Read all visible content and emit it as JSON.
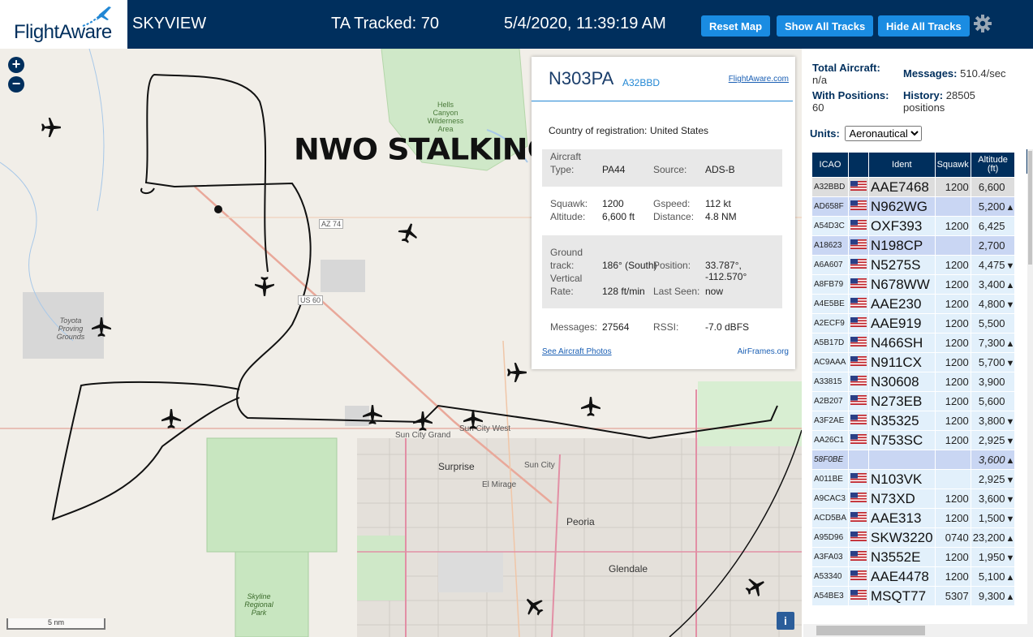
{
  "header": {
    "logo_text": "FlightAware",
    "app_title": "SKYVIEW",
    "tracked": "TA Tracked: 70",
    "datetime": "5/4/2020, 11:39:19 AM",
    "buttons": {
      "reset": "Reset Map",
      "show_all": "Show All Tracks",
      "hide_all": "Hide All Tracks"
    },
    "accent": "#1a8ce2",
    "bg": "#002f5d"
  },
  "map": {
    "overlay_text": "NWO STALKING",
    "labels": {
      "toyota": "Toyota Proving Grounds",
      "hells": "Hells Canyon Wilderness Area",
      "az74": "AZ 74",
      "us60": "US 60",
      "sun_city_grand": "Sun City Grand",
      "sun_city_west": "Sun City West",
      "surprise": "Surprise",
      "sun_city": "Sun City",
      "el_mirage": "El Mirage",
      "peoria": "Peoria",
      "glendale": "Glendale",
      "skyline": "Skyline Regional Park"
    },
    "scale": "5 nm",
    "info": "i",
    "zoom_in": "+",
    "zoom_out": "−"
  },
  "selected": {
    "callsign": "N303PA",
    "hex": "A32BBD",
    "fa_link": "FlightAware.com",
    "country_label": "Country of registration:",
    "country": "United States",
    "aircraft_type_label1": "Aircraft",
    "aircraft_type_label2": "Type:",
    "aircraft_type": "PA44",
    "source_label": "Source:",
    "source": "ADS-B",
    "squawk_label": "Squawk:",
    "squawk": "1200",
    "gspeed_label": "Gspeed:",
    "gspeed": "112 kt",
    "altitude_label": "Altitude:",
    "altitude": "6,600 ft",
    "distance_label": "Distance:",
    "distance": "4.8 NM",
    "gt_label1": "Ground",
    "gt_label2": "track:",
    "ground_track": "186° (South)",
    "position_label": "Position:",
    "position": "33.787°, -112.570°",
    "vr_label1": "Vertical",
    "vr_label2": "Rate:",
    "vertical_rate": "128 ft/min",
    "last_seen_label": "Last Seen:",
    "last_seen": "now",
    "messages_label": "Messages:",
    "messages": "27564",
    "rssi_label": "RSSI:",
    "rssi": "-7.0 dBFS",
    "photos_link": "See Aircraft Photos",
    "airframes_link": "AirFrames.org"
  },
  "sidebar": {
    "total_label": "Total Aircraft:",
    "total_value": "n/a",
    "messages_label": "Messages:",
    "messages_value": "510.4/sec",
    "positions_label": "With Positions:",
    "positions_value": "60",
    "history_label": "History:",
    "history_value": "28505",
    "history_unit": "positions",
    "units_label": "Units:",
    "units_value": "Aeronautical",
    "columns": [
      "ICAO",
      "",
      "Ident",
      "Squawk",
      "Altitude (ft)"
    ],
    "rows": [
      {
        "icao": "A32BBD",
        "ident": "AAE7468",
        "squawk": "1200",
        "alt": "6,600",
        "trend": "",
        "style": "selected"
      },
      {
        "icao": "AD658F",
        "ident": "N962WG",
        "squawk": "",
        "alt": "5,200",
        "trend": "▲",
        "style": "mlat"
      },
      {
        "icao": "A54D3C",
        "ident": "OXF393",
        "squawk": "1200",
        "alt": "6,425",
        "trend": "",
        "style": "normal"
      },
      {
        "icao": "A18623",
        "ident": "N198CP",
        "squawk": "",
        "alt": "2,700",
        "trend": "",
        "style": "mlat"
      },
      {
        "icao": "A6A607",
        "ident": "N5275S",
        "squawk": "1200",
        "alt": "4,475",
        "trend": "▼",
        "style": "normal"
      },
      {
        "icao": "A8FB79",
        "ident": "N678WW",
        "squawk": "1200",
        "alt": "3,400",
        "trend": "▲",
        "style": "normal"
      },
      {
        "icao": "A4E5BE",
        "ident": "AAE230",
        "squawk": "1200",
        "alt": "4,800",
        "trend": "▼",
        "style": "normal"
      },
      {
        "icao": "A2ECF9",
        "ident": "AAE919",
        "squawk": "1200",
        "alt": "5,500",
        "trend": "",
        "style": "normal"
      },
      {
        "icao": "A5B17D",
        "ident": "N466SH",
        "squawk": "1200",
        "alt": "7,300",
        "trend": "▲",
        "style": "normal"
      },
      {
        "icao": "AC9AAA",
        "ident": "N911CX",
        "squawk": "1200",
        "alt": "5,700",
        "trend": "▼",
        "style": "normal"
      },
      {
        "icao": "A33815",
        "ident": "N30608",
        "squawk": "1200",
        "alt": "3,900",
        "trend": "",
        "style": "normal"
      },
      {
        "icao": "A2B207",
        "ident": "N273EB",
        "squawk": "1200",
        "alt": "5,600",
        "trend": "",
        "style": "normal"
      },
      {
        "icao": "A3F2AE",
        "ident": "N35325",
        "squawk": "1200",
        "alt": "3,800",
        "trend": "▼",
        "style": "normal"
      },
      {
        "icao": "AA26C1",
        "ident": "N753SC",
        "squawk": "1200",
        "alt": "2,925",
        "trend": "▼",
        "style": "normal"
      },
      {
        "icao": "58F0BE",
        "ident": "",
        "squawk": "",
        "alt": "3,600",
        "trend": "▲",
        "style": "tisb"
      },
      {
        "icao": "A011BE",
        "ident": "N103VK",
        "squawk": "",
        "alt": "2,925",
        "trend": "▼",
        "style": "normal"
      },
      {
        "icao": "A9CAC3",
        "ident": "N73XD",
        "squawk": "1200",
        "alt": "3,600",
        "trend": "▼",
        "style": "normal"
      },
      {
        "icao": "ACD5BA",
        "ident": "AAE313",
        "squawk": "1200",
        "alt": "1,500",
        "trend": "▼",
        "style": "normal"
      },
      {
        "icao": "A95D96",
        "ident": "SKW3220",
        "squawk": "0740",
        "alt": "23,200",
        "trend": "▲",
        "style": "normal"
      },
      {
        "icao": "A3FA03",
        "ident": "N3552E",
        "squawk": "1200",
        "alt": "1,950",
        "trend": "▼",
        "style": "normal"
      },
      {
        "icao": "A53340",
        "ident": "AAE4478",
        "squawk": "1200",
        "alt": "5,100",
        "trend": "▲",
        "style": "normal"
      },
      {
        "icao": "A54BE3",
        "ident": "MSQT77",
        "squawk": "5307",
        "alt": "9,300",
        "trend": "▲",
        "style": "normal"
      }
    ],
    "row_colors": {
      "normal": "#e2f0fb",
      "mlat": "#c9d6f3",
      "selected": "#dddddd",
      "tisb": "#c9d6f3",
      "header": "#002f5d"
    }
  }
}
